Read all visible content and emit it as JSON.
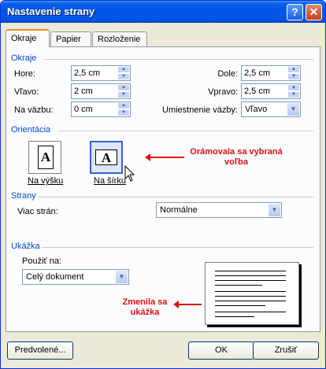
{
  "window": {
    "title": "Nastavenie strany",
    "help_label": "?",
    "close_label": "✕"
  },
  "tabs": [
    {
      "label": "Okraje",
      "active": true
    },
    {
      "label": "Papier",
      "active": false
    },
    {
      "label": "Rozloženie",
      "active": false
    }
  ],
  "margins": {
    "title": "Okraje",
    "top": {
      "label": "Hore:",
      "value": "2,5 cm"
    },
    "bottom": {
      "label": "Dole:",
      "value": "2,5 cm"
    },
    "left": {
      "label": "Vľavo:",
      "value": "2 cm"
    },
    "right": {
      "label": "Vpravo:",
      "value": "2,5 cm"
    },
    "gutter": {
      "label": "Na väzbu:",
      "value": "0 cm"
    },
    "gutter_position": {
      "label": "Umiestnenie väzby:",
      "value": "Vľavo"
    }
  },
  "orientation": {
    "title": "Orientácia",
    "portrait_label": "Na výšku",
    "landscape_label": "Na šírku",
    "glyph": "A",
    "selected": "landscape",
    "callout": "Orámovala sa vybraná voľba"
  },
  "pages": {
    "title": "Strany",
    "multiple_label": "Viac strán:",
    "multiple_value": "Normálne"
  },
  "preview": {
    "title": "Ukážka",
    "apply_label": "Použiť na:",
    "apply_value": "Celý dokument",
    "callout": "Zmenila sa ukážka"
  },
  "buttons": {
    "default": "Predvolené...",
    "ok": "OK",
    "cancel": "Zrušiť"
  },
  "icons": {
    "spin": "spin-arrows-icon",
    "dropdown": "chevron-down-icon",
    "cursor": "mouse-pointer-icon"
  }
}
